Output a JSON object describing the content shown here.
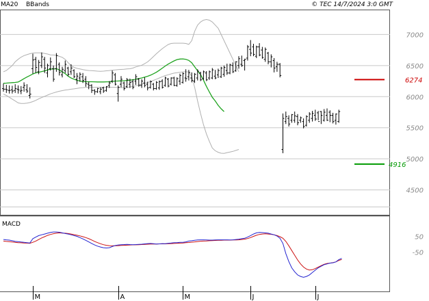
{
  "header": {
    "legend_ma": "MA20",
    "legend_bb": "BBands",
    "stamp": "© TEC 14/7/2024 3:0 GMT"
  },
  "colors": {
    "price": "#000000",
    "ma20": "#1fa31f",
    "bbands": "#b0b0b0",
    "resistance": "#cc0000",
    "support": "#009900",
    "macd": "#2323d0",
    "signal": "#cc1111",
    "grid": "#c8c8c8",
    "axis": "#555555"
  },
  "levels": {
    "resistance": {
      "value": 6274,
      "label": "6274"
    },
    "support": {
      "value": 4916,
      "label": "4916"
    }
  },
  "macd_panel": {
    "title": "MACD",
    "ticks": [
      {
        "value": 50,
        "label": "50"
      },
      {
        "value": -50,
        "label": "-50"
      }
    ]
  },
  "chart_data": {
    "type": "bar",
    "title": "",
    "ylim": [
      4100,
      7400
    ],
    "yticks": [
      4500,
      5000,
      5500,
      6000,
      6500,
      7000
    ],
    "ytick_labels": [
      "4500",
      "5000",
      "5500",
      "6000",
      "6500",
      "7000"
    ],
    "month_labels": [
      {
        "label": "M",
        "index": 10
      },
      {
        "label": "A",
        "index": 39
      },
      {
        "label": "M",
        "index": 61
      },
      {
        "label": "J",
        "index": 84
      },
      {
        "label": "J",
        "index": 106
      }
    ],
    "series": [
      {
        "name": "Price",
        "kind": "ohlc",
        "high": [
          6210,
          6190,
          6180,
          6175,
          6200,
          6180,
          6170,
          6230,
          6200,
          6150,
          6690,
          6640,
          6590,
          6710,
          6640,
          6530,
          6630,
          6500,
          6700,
          6550,
          6480,
          6580,
          6480,
          6520,
          6440,
          6380,
          6390,
          6380,
          6330,
          6240,
          6200,
          6120,
          6140,
          6150,
          6160,
          6170,
          6250,
          6420,
          6380,
          6180,
          6330,
          6240,
          6300,
          6290,
          6280,
          6360,
          6300,
          6280,
          6310,
          6240,
          6260,
          6220,
          6250,
          6260,
          6280,
          6320,
          6300,
          6310,
          6320,
          6310,
          6370,
          6390,
          6440,
          6430,
          6390,
          6380,
          6440,
          6400,
          6420,
          6410,
          6420,
          6460,
          6430,
          6450,
          6480,
          6500,
          6530,
          6530,
          6550,
          6570,
          6650,
          6660,
          6610,
          6830,
          6910,
          6850,
          6820,
          6860,
          6800,
          6790,
          6720,
          6680,
          6620,
          6560,
          6540,
          5730,
          5760,
          5700,
          5720,
          5760,
          5720,
          5680,
          5650,
          5700,
          5750,
          5770,
          5790,
          5770,
          5770,
          5800,
          5810,
          5780,
          5740,
          5730,
          5790
        ],
        "low": [
          6080,
          6060,
          6050,
          6050,
          6060,
          6050,
          6040,
          6080,
          6060,
          5970,
          6370,
          6380,
          6360,
          6460,
          6380,
          6310,
          6420,
          6240,
          6400,
          6340,
          6310,
          6380,
          6330,
          6350,
          6300,
          6200,
          6240,
          6220,
          6160,
          6120,
          6060,
          6030,
          6060,
          6040,
          6060,
          6080,
          6140,
          6220,
          6180,
          5920,
          6150,
          6100,
          6140,
          6140,
          6120,
          6190,
          6160,
          6140,
          6150,
          6100,
          6130,
          6100,
          6110,
          6110,
          6130,
          6160,
          6150,
          6180,
          6170,
          6160,
          6190,
          6210,
          6240,
          6260,
          6230,
          6220,
          6260,
          6250,
          6270,
          6250,
          6270,
          6280,
          6280,
          6300,
          6300,
          6320,
          6350,
          6360,
          6380,
          6400,
          6450,
          6480,
          6420,
          6580,
          6650,
          6650,
          6620,
          6650,
          6610,
          6560,
          6520,
          6470,
          6390,
          6400,
          6310,
          5090,
          5560,
          5520,
          5580,
          5580,
          5540,
          5580,
          5490,
          5520,
          5580,
          5600,
          5610,
          5620,
          5560,
          5600,
          5610,
          5590,
          5570,
          5550,
          5580
        ],
        "open": [
          6130,
          6120,
          6100,
          6110,
          6100,
          6120,
          6090,
          6150,
          6110,
          6020,
          6450,
          6600,
          6400,
          6500,
          6600,
          6380,
          6450,
          6450,
          6450,
          6520,
          6350,
          6420,
          6460,
          6400,
          6420,
          6280,
          6300,
          6320,
          6280,
          6200,
          6180,
          6100,
          6080,
          6080,
          6140,
          6100,
          6180,
          6250,
          6350,
          6050,
          6200,
          6220,
          6160,
          6200,
          6240,
          6250,
          6280,
          6180,
          6220,
          6200,
          6150,
          6200,
          6130,
          6140,
          6250,
          6180,
          6280,
          6200,
          6300,
          6180,
          6250,
          6230,
          6300,
          6320,
          6300,
          6250,
          6300,
          6380,
          6290,
          6380,
          6300,
          6300,
          6330,
          6350,
          6320,
          6360,
          6420,
          6380,
          6500,
          6420,
          6500,
          6520,
          6580,
          6620,
          6760,
          6800,
          6650,
          6800,
          6750,
          6600,
          6700,
          6560,
          6580,
          6480,
          6520,
          5150,
          5600,
          5650,
          5620,
          5620,
          5680,
          5620,
          5600,
          5540,
          5620,
          5650,
          5700,
          5740,
          5760,
          5620,
          5700,
          5750,
          5700,
          5620,
          5600
        ],
        "close": [
          6120,
          6110,
          6100,
          6090,
          6130,
          6110,
          6100,
          6180,
          6090,
          6040,
          6590,
          6470,
          6550,
          6640,
          6460,
          6500,
          6560,
          6280,
          6660,
          6390,
          6440,
          6520,
          6360,
          6460,
          6320,
          6330,
          6360,
          6260,
          6210,
          6180,
          6100,
          6080,
          6130,
          6120,
          6090,
          6160,
          6220,
          6380,
          6200,
          6150,
          6280,
          6130,
          6270,
          6230,
          6150,
          6320,
          6180,
          6250,
          6180,
          6140,
          6240,
          6130,
          6230,
          6240,
          6150,
          6300,
          6170,
          6300,
          6180,
          6290,
          6340,
          6370,
          6290,
          6390,
          6260,
          6360,
          6410,
          6270,
          6400,
          6270,
          6400,
          6430,
          6300,
          6420,
          6460,
          6470,
          6380,
          6510,
          6400,
          6560,
          6610,
          6500,
          6600,
          6800,
          6700,
          6680,
          6800,
          6670,
          6630,
          6760,
          6560,
          6640,
          6460,
          6520,
          6340,
          5650,
          5680,
          5560,
          5710,
          5690,
          5580,
          5660,
          5520,
          5680,
          5720,
          5730,
          5640,
          5600,
          5700,
          5750,
          5620,
          5700,
          5600,
          5720,
          5760
        ]
      },
      {
        "name": "MA20",
        "kind": "line",
        "x_start": 0,
        "values": [
          6215,
          6218,
          6222,
          6225,
          6228,
          6235,
          6260,
          6290,
          6315,
          6340,
          6365,
          6382,
          6392,
          6403,
          6414,
          6430,
          6443,
          6445,
          6450,
          6430,
          6400,
          6370,
          6330,
          6300,
          6280,
          6263,
          6250,
          6244,
          6240,
          6240,
          6240,
          6238,
          6236,
          6236,
          6236,
          6238,
          6240,
          6245,
          6250,
          6252,
          6254,
          6256,
          6260,
          6265,
          6270,
          6280,
          6290,
          6300,
          6313,
          6328,
          6345,
          6368,
          6392,
          6424,
          6458,
          6492,
          6523,
          6550,
          6575,
          6596,
          6605,
          6607,
          6600,
          6583,
          6545,
          6480,
          6415,
          6355,
          6265,
          6165,
          6075,
          5990,
          5930,
          5860,
          5805,
          5760
        ]
      },
      {
        "name": "BBands upper",
        "kind": "line",
        "x_start": 0,
        "values": [
          6400,
          6420,
          6460,
          6500,
          6560,
          6600,
          6635,
          6660,
          6675,
          6690,
          6700,
          6705,
          6705,
          6705,
          6695,
          6685,
          6672,
          6670,
          6664,
          6648,
          6632,
          6598,
          6546,
          6500,
          6470,
          6455,
          6445,
          6435,
          6427,
          6420,
          6418,
          6414,
          6410,
          6408,
          6410,
          6415,
          6420,
          6425,
          6430,
          6434,
          6438,
          6440,
          6445,
          6448,
          6460,
          6478,
          6490,
          6505,
          6530,
          6558,
          6600,
          6645,
          6690,
          6732,
          6772,
          6806,
          6838,
          6855,
          6860,
          6860,
          6860,
          6860,
          6855,
          6840,
          6900,
          7050,
          7150,
          7200,
          7230,
          7240,
          7230,
          7200,
          7150,
          7100,
          7000,
          6900,
          6800,
          6700,
          6600,
          6500,
          6400
        ]
      },
      {
        "name": "BBands lower",
        "kind": "line",
        "x_start": 0,
        "values": [
          6040,
          6020,
          5990,
          5960,
          5930,
          5900,
          5890,
          5890,
          5895,
          5905,
          5920,
          5940,
          5965,
          5985,
          6005,
          6025,
          6045,
          6060,
          6075,
          6087,
          6097,
          6106,
          6112,
          6120,
          6125,
          6133,
          6140,
          6145,
          6150,
          6150,
          6150,
          6150,
          6150,
          6150,
          6150,
          6150,
          6150,
          6150,
          6150,
          6148,
          6145,
          6146,
          6150,
          6156,
          6164,
          6176,
          6188,
          6200,
          6214,
          6228,
          6244,
          6262,
          6280,
          6300,
          6320,
          6338,
          6352,
          6366,
          6378,
          6385,
          6392,
          6398,
          6400,
          6396,
          6328,
          6150,
          5930,
          5730,
          5550,
          5400,
          5280,
          5175,
          5130,
          5105,
          5090,
          5088,
          5100,
          5110,
          5120,
          5135,
          5150
        ]
      },
      {
        "name": "MACD",
        "kind": "macd_line",
        "values": [
          30,
          28,
          26,
          22,
          18,
          16,
          14,
          12,
          10,
          8,
          35,
          45,
          55,
          60,
          65,
          70,
          75,
          78,
          78,
          76,
          72,
          68,
          65,
          60,
          55,
          50,
          42,
          34,
          25,
          15,
          5,
          -5,
          -12,
          -18,
          -22,
          -24,
          -22,
          -15,
          -8,
          -5,
          -3,
          -2,
          -1,
          -2,
          -3,
          -2,
          -1,
          0,
          2,
          4,
          5,
          3,
          1,
          2,
          4,
          3,
          6,
          8,
          10,
          10,
          12,
          12,
          15,
          20,
          22,
          25,
          27,
          28,
          28,
          27,
          26,
          26,
          27,
          28,
          28,
          28,
          28,
          27,
          28,
          30,
          32,
          35,
          38,
          45,
          55,
          65,
          72,
          75,
          74,
          72,
          70,
          65,
          60,
          52,
          38,
          5,
          -60,
          -110,
          -150,
          -175,
          -195,
          -205,
          -210,
          -205,
          -195,
          -180,
          -165,
          -150,
          -140,
          -130,
          -125,
          -120,
          -118,
          -112,
          -98,
          -90
        ]
      },
      {
        "name": "Signal",
        "kind": "macd_line",
        "values": [
          20,
          18,
          16,
          14,
          12,
          10,
          9,
          8,
          7,
          6,
          12,
          20,
          30,
          40,
          48,
          56,
          62,
          67,
          70,
          72,
          71,
          70,
          68,
          65,
          61,
          57,
          53,
          48,
          42,
          35,
          27,
          18,
          10,
          3,
          -3,
          -7,
          -9,
          -10,
          -10,
          -9,
          -8,
          -7,
          -6,
          -5,
          -4,
          -4,
          -3,
          -2,
          -1,
          0,
          1,
          1,
          1,
          2,
          2,
          2,
          3,
          4,
          5,
          6,
          7,
          8,
          10,
          11,
          13,
          15,
          17,
          19,
          20,
          21,
          22,
          23,
          24,
          25,
          25,
          26,
          26,
          26,
          27,
          27,
          28,
          30,
          32,
          36,
          42,
          50,
          57,
          62,
          65,
          66,
          65,
          63,
          60,
          55,
          48,
          38,
          18,
          -10,
          -40,
          -70,
          -100,
          -125,
          -145,
          -158,
          -164,
          -162,
          -155,
          -145,
          -136,
          -128,
          -122,
          -120,
          -117,
          -112,
          -103,
          -97
        ]
      }
    ]
  }
}
